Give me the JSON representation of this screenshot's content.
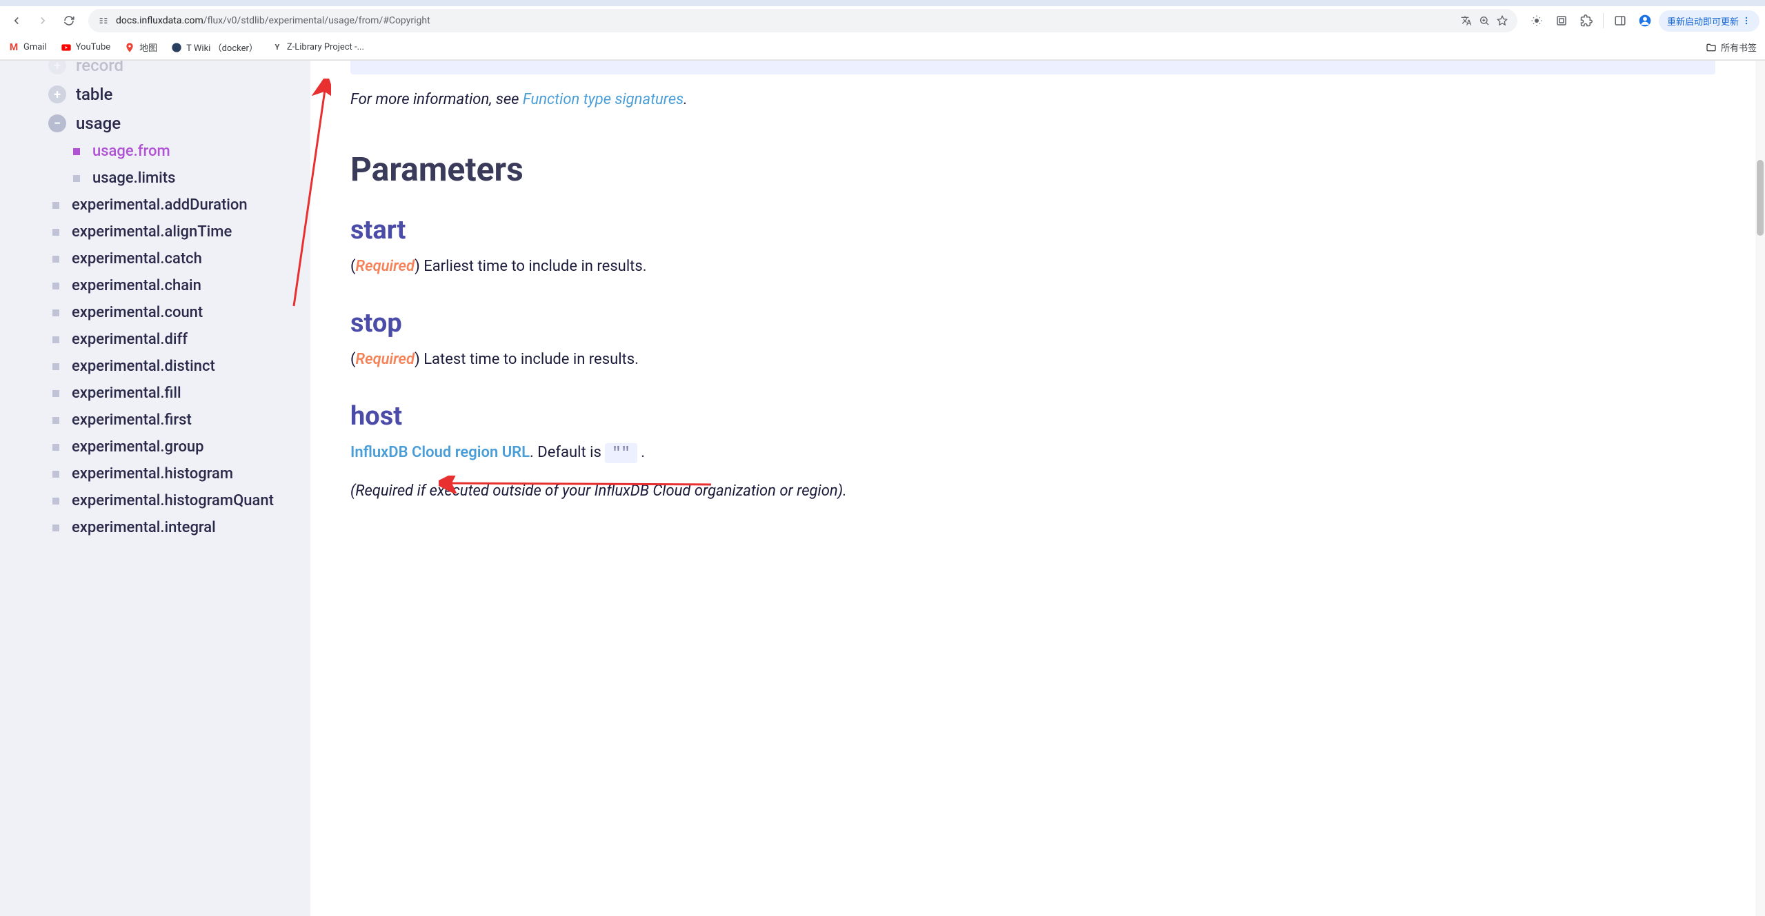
{
  "url": {
    "domain": "docs.influxdata.com",
    "path": "/flux/v0/stdlib/experimental/usage/from/#Copyright"
  },
  "bookmarks": {
    "gmail": "Gmail",
    "youtube": "YouTube",
    "maps": "地图",
    "twiki": "T Wiki （docker）",
    "zlib": "Z-Library Project -...",
    "all": "所有书签"
  },
  "update_button": "重新启动即可更新",
  "sidebar": {
    "record": "record",
    "table": "table",
    "usage": "usage",
    "usage_from": "usage.from",
    "usage_limits": "usage.limits",
    "exp_items": [
      "experimental.addDuration",
      "experimental.alignTime",
      "experimental.catch",
      "experimental.chain",
      "experimental.count",
      "experimental.diff",
      "experimental.distinct",
      "experimental.fill",
      "experimental.first",
      "experimental.group",
      "experimental.histogram",
      "experimental.histogramQuant",
      "experimental.integral"
    ]
  },
  "content": {
    "info_prefix": "For more information, see ",
    "info_link": "Function type signatures",
    "info_suffix": ".",
    "parameters_heading": "Parameters",
    "params": {
      "start": {
        "name": "start",
        "required": "Required",
        "desc": "Earliest time to include in results."
      },
      "stop": {
        "name": "stop",
        "required": "Required",
        "desc": "Latest time to include in results."
      },
      "host": {
        "name": "host",
        "link": "InfluxDB Cloud region URL",
        "desc_mid": ". Default is ",
        "default_val": "\"\"",
        "desc_end": ".",
        "note": "(Required if executed outside of your InfluxDB Cloud organization or region)."
      }
    }
  }
}
